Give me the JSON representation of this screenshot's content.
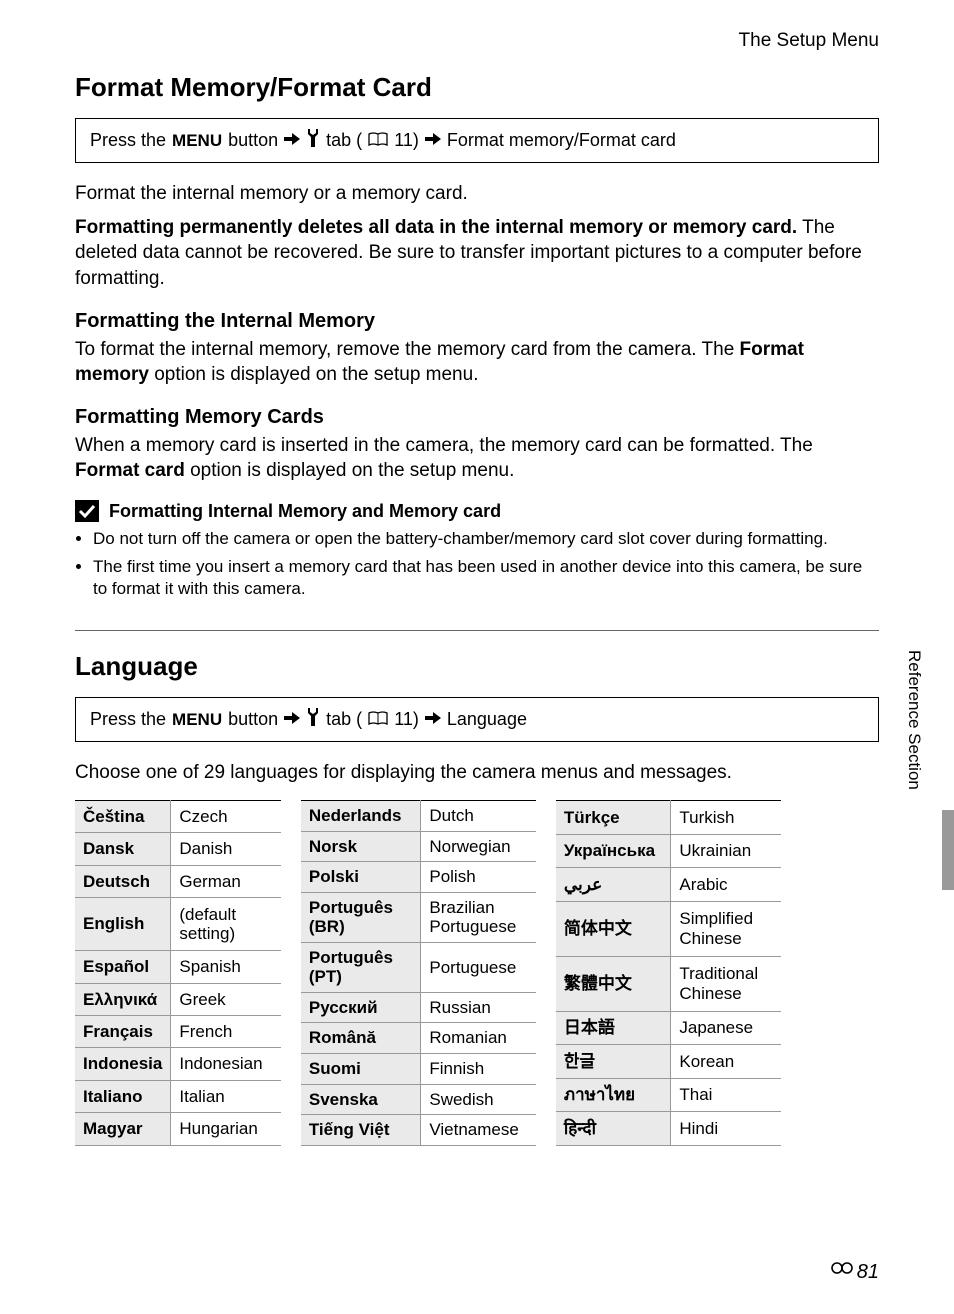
{
  "header": "The Setup Menu",
  "section1": {
    "title": "Format Memory/Format Card",
    "nav": {
      "press": "Press the ",
      "menu": "MENU",
      "button": " button ",
      "tab_ref": " tab (",
      "page": "11) ",
      "dest": " Format memory/Format card"
    },
    "p1a": "Format the internal memory or a memory card.",
    "p1b": "Formatting permanently deletes all data in the internal memory or memory card.",
    "p1c": "  The deleted data cannot be recovered. Be sure to transfer important pictures to a computer before formatting.",
    "sub1_title": "Formatting the Internal Memory",
    "sub1_a": "To format the internal memory, remove the memory card from the camera. The ",
    "sub1_b": "Format memory",
    "sub1_c": " option is displayed on the setup menu.",
    "sub2_title": "Formatting Memory Cards",
    "sub2_a": "When a memory card is inserted in the camera, the memory card can be formatted. The ",
    "sub2_b": "Format card",
    "sub2_c": " option is displayed on the setup menu.",
    "note_title": "Formatting Internal Memory and Memory card",
    "bullet1": "Do not turn off the camera or open the battery-chamber/memory card slot cover during formatting.",
    "bullet2": "The first time you insert a memory card that has been used in another device into this camera, be sure to format it with this camera."
  },
  "section2": {
    "title": "Language",
    "nav": {
      "press": "Press the ",
      "menu": "MENU",
      "button": " button ",
      "tab_ref": " tab (",
      "page": "11) ",
      "dest": " Language"
    },
    "intro": "Choose one of 29 languages for displaying the camera menus and messages.",
    "table1": [
      {
        "native": "Čeština",
        "eng": "Czech"
      },
      {
        "native": "Dansk",
        "eng": "Danish"
      },
      {
        "native": "Deutsch",
        "eng": "German"
      },
      {
        "native": "English",
        "eng": "(default setting)"
      },
      {
        "native": "Español",
        "eng": "Spanish"
      },
      {
        "native": "Ελληνικά",
        "eng": "Greek"
      },
      {
        "native": "Français",
        "eng": "French"
      },
      {
        "native": "Indonesia",
        "eng": "Indonesian"
      },
      {
        "native": "Italiano",
        "eng": "Italian"
      },
      {
        "native": "Magyar",
        "eng": "Hungarian"
      }
    ],
    "table2": [
      {
        "native": "Nederlands",
        "eng": "Dutch"
      },
      {
        "native": "Norsk",
        "eng": "Norwegian"
      },
      {
        "native": "Polski",
        "eng": "Polish"
      },
      {
        "native": "Português (BR)",
        "eng": "Brazilian Portuguese"
      },
      {
        "native": "Português (PT)",
        "eng": "Portuguese"
      },
      {
        "native": "Русский",
        "eng": "Russian"
      },
      {
        "native": "Română",
        "eng": "Romanian"
      },
      {
        "native": "Suomi",
        "eng": "Finnish"
      },
      {
        "native": "Svenska",
        "eng": "Swedish"
      },
      {
        "native": "Tiếng Việt",
        "eng": "Vietnamese"
      }
    ],
    "table3": [
      {
        "native": "Türkçe",
        "eng": "Turkish"
      },
      {
        "native": "Українська",
        "eng": "Ukrainian"
      },
      {
        "native": "عربي",
        "eng": "Arabic"
      },
      {
        "native": "简体中文",
        "eng": "Simplified Chinese"
      },
      {
        "native": "繁體中文",
        "eng": "Traditional Chinese"
      },
      {
        "native": "日本語",
        "eng": "Japanese"
      },
      {
        "native": "한글",
        "eng": "Korean"
      },
      {
        "native": "ภาษาไทย",
        "eng": "Thai"
      },
      {
        "native": "हिन्दी",
        "eng": "Hindi"
      }
    ]
  },
  "side_label": "Reference Section",
  "page_number": "81"
}
